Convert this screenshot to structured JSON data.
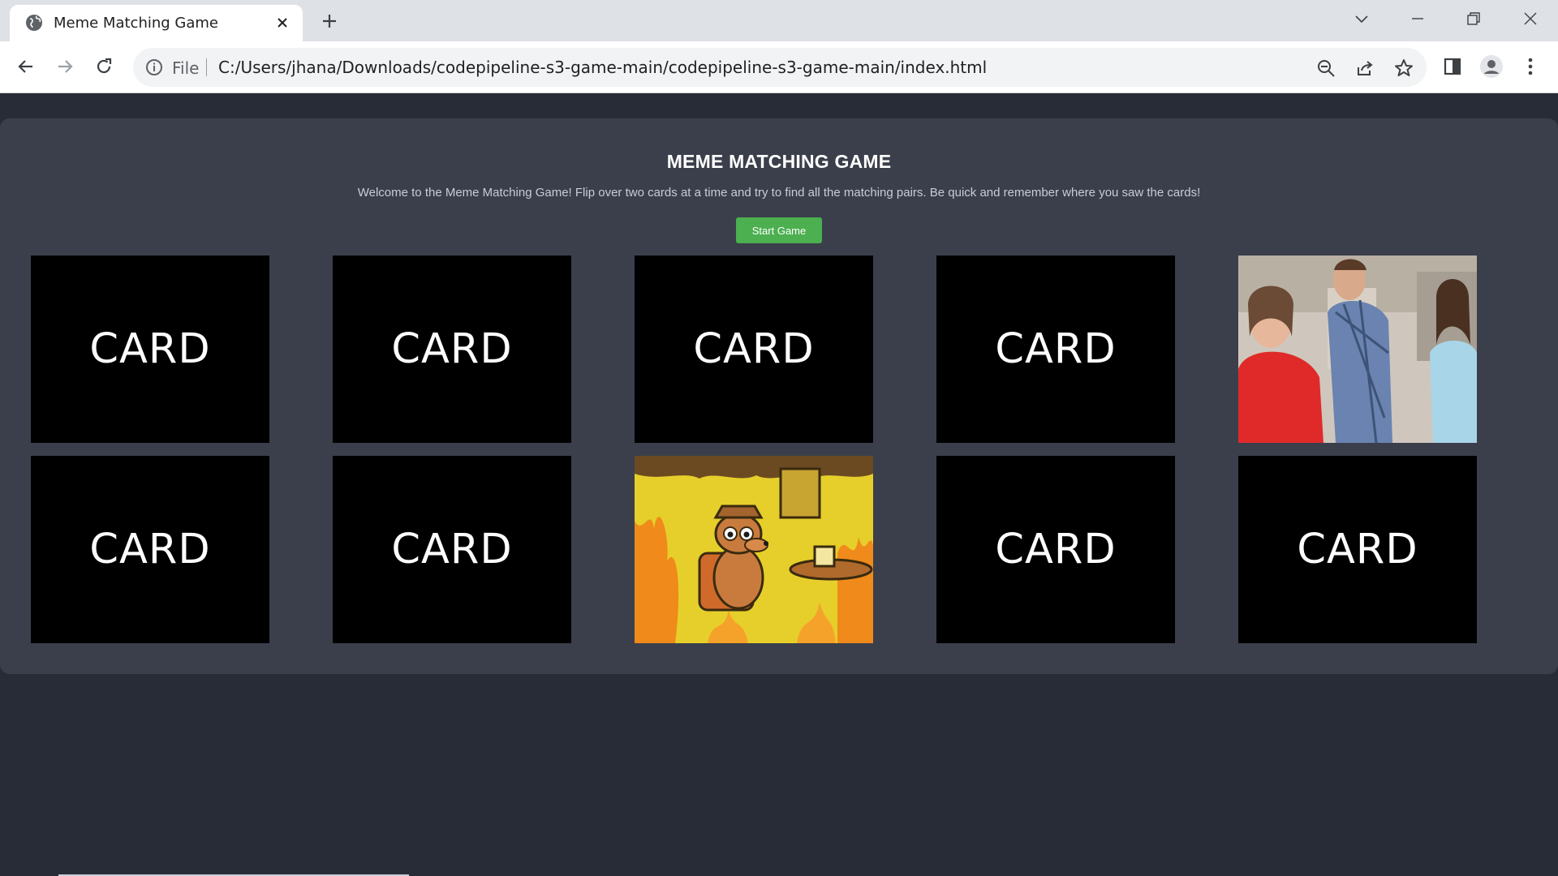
{
  "browser": {
    "tab_title": "Meme Matching Game",
    "scheme_label": "File",
    "url": "C:/Users/jhana/Downloads/codepipeline-s3-game-main/codepipeline-s3-game-main/index.html"
  },
  "game": {
    "title": "MEME MATCHING GAME",
    "description": "Welcome to the Meme Matching Game! Flip over two cards at a time and try to find all the matching pairs. Be quick and remember where you saw the cards!",
    "start_button": "Start Game",
    "cards": [
      {
        "state": "face-down",
        "label": "CARD"
      },
      {
        "state": "face-down",
        "label": "CARD"
      },
      {
        "state": "face-down",
        "label": "CARD"
      },
      {
        "state": "face-down",
        "label": "CARD"
      },
      {
        "state": "face-up",
        "meme": "distracted-boyfriend"
      },
      {
        "state": "face-down",
        "label": "CARD"
      },
      {
        "state": "face-down",
        "label": "CARD"
      },
      {
        "state": "face-up",
        "meme": "this-is-fine-dog"
      },
      {
        "state": "face-down",
        "label": "CARD"
      },
      {
        "state": "face-down",
        "label": "CARD"
      }
    ]
  },
  "colors": {
    "page_bg": "#282c36",
    "panel_bg": "#3b3f4b",
    "start_button": "#4caf50",
    "card_back": "#000000"
  }
}
